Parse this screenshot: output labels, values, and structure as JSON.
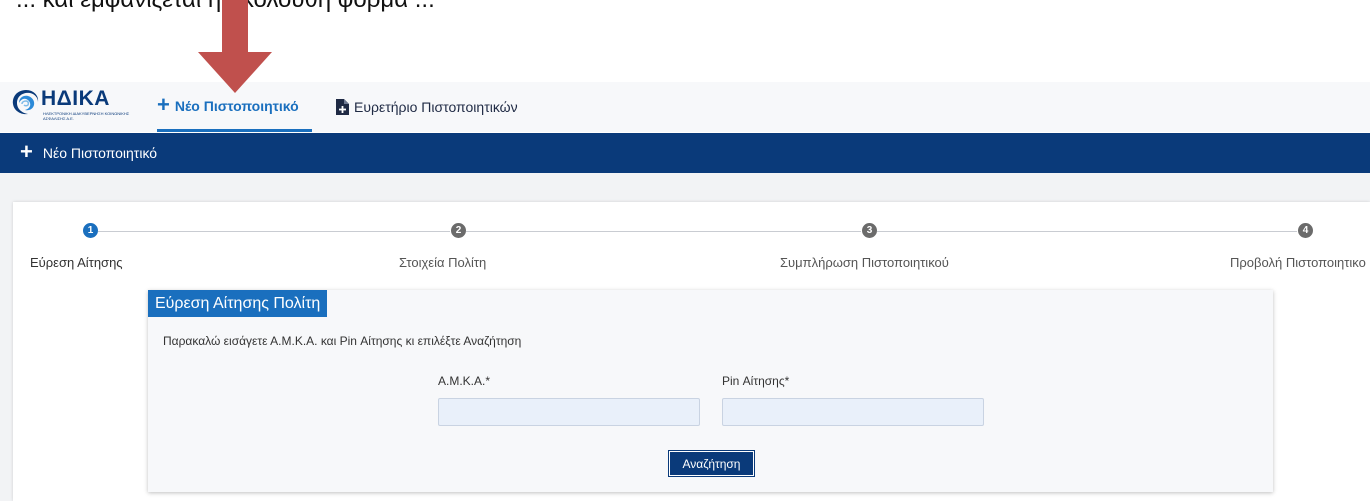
{
  "annotation_text": "... και εμφανίζεται η ακόλουθη φόρμα ...",
  "logo": {
    "name": "ΗΔΙΚΑ",
    "subtitle": "ΗΛΕΚΤΡΟΝΙΚΗ ΔΙΑΚΥΒΕΡΝΗΣΗ ΚΟΙΝΩΝΙΚΗΣ ΑΣΦΑΛΙΣΗΣ Α.Ε."
  },
  "nav": {
    "new_certificate": "Νέο Πιστοποιητικό",
    "certificate_index": "Ευρετήριο Πιστοποιητικών"
  },
  "header": {
    "title": "Νέο Πιστοποιητικό"
  },
  "stepper": {
    "steps": [
      {
        "number": "1",
        "label": "Εύρεση Αίτησης"
      },
      {
        "number": "2",
        "label": "Στοιχεία Πολίτη"
      },
      {
        "number": "3",
        "label": "Συμπλήρωση Πιστοποιητικού"
      },
      {
        "number": "4",
        "label": "Προβολή Πιστοποιητικο"
      }
    ]
  },
  "search_panel": {
    "title": "Εύρεση Αίτησης Πολίτη",
    "instructions": "Παρακαλώ εισάγετε Α.Μ.Κ.Α. και Pin Αίτησης κι επιλέξτε Αναζήτηση",
    "amka_label": "Α.Μ.Κ.Α.*",
    "amka_value": "",
    "pin_label": "Pin Αίτησης*",
    "pin_value": "",
    "search_button": "Αναζήτηση"
  },
  "colors": {
    "brand_dark": "#0a3a7a",
    "brand_accent": "#1a6fbe",
    "annotation_arrow": "#c0504d"
  }
}
